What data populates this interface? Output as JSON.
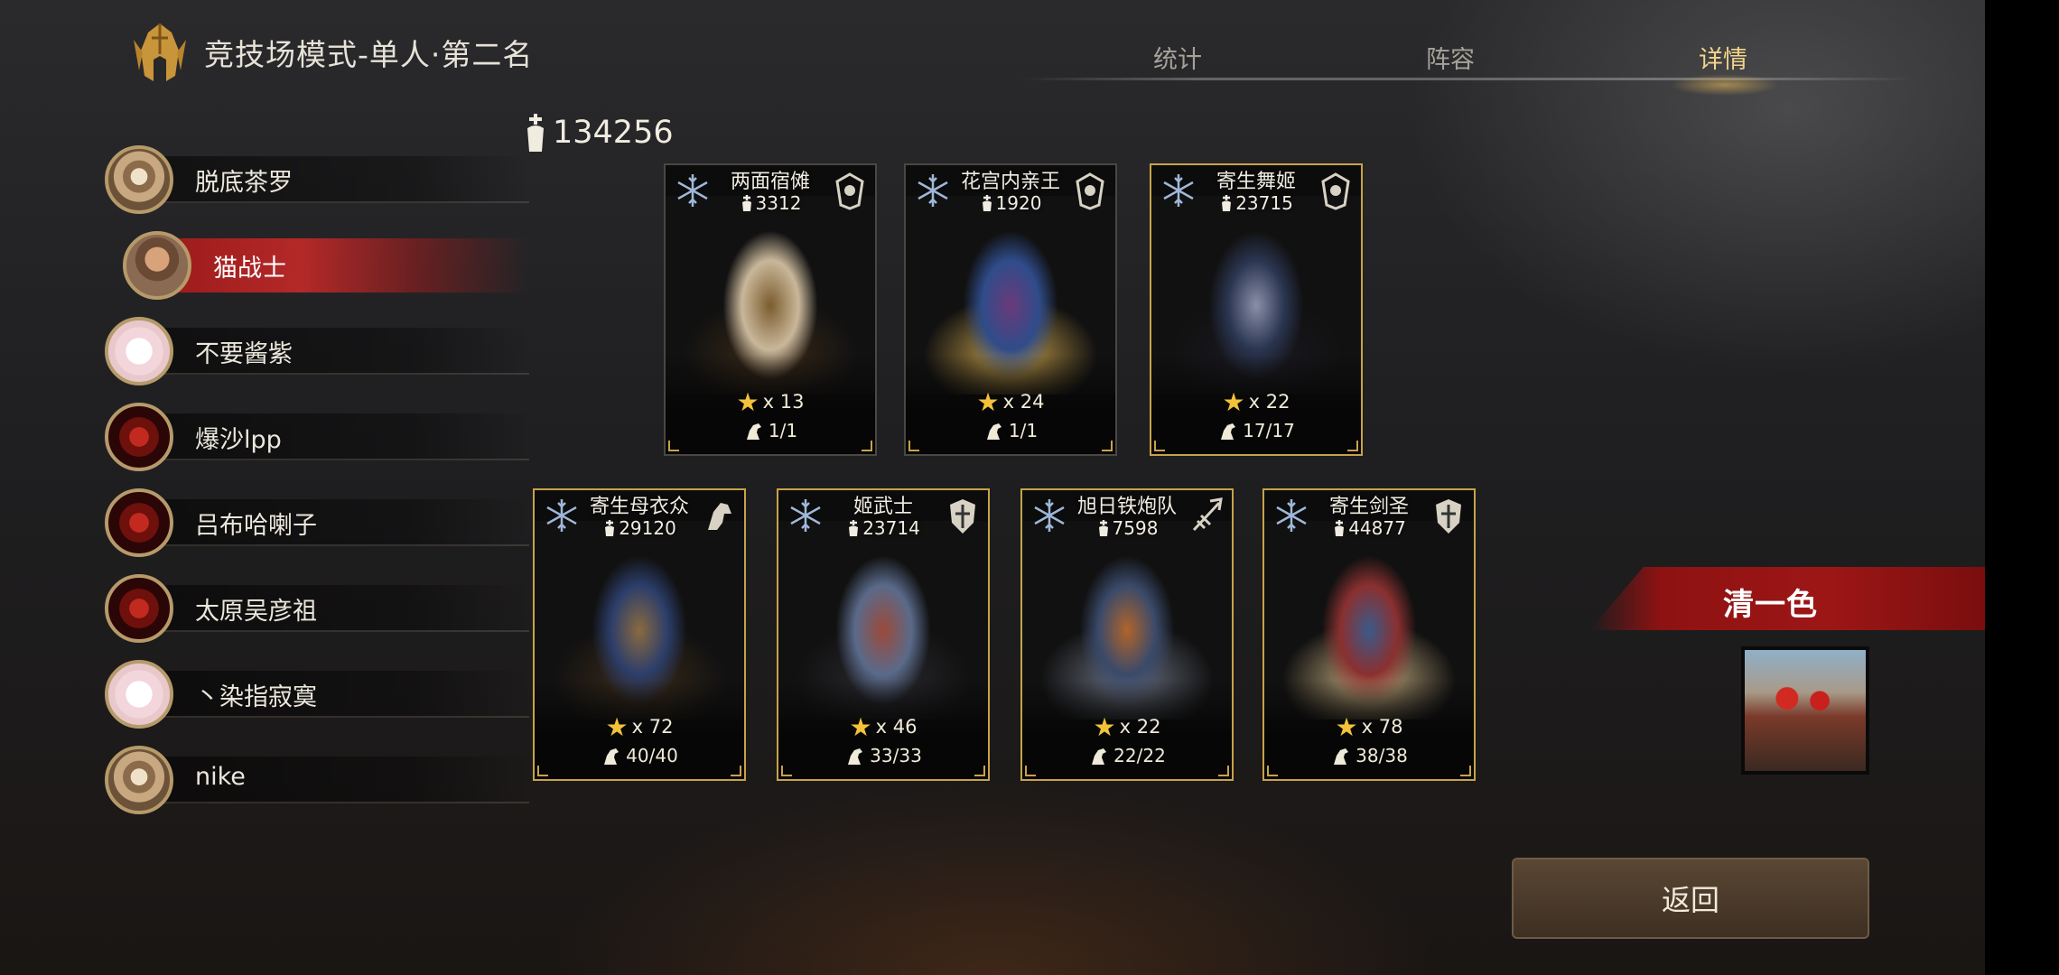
{
  "header": {
    "title": "竞技场模式-单人·第二名"
  },
  "tabs": [
    {
      "label": "统计",
      "active": false
    },
    {
      "label": "阵容",
      "active": false
    },
    {
      "label": "详情",
      "active": true
    }
  ],
  "players": [
    {
      "name": "脱底茶罗",
      "avatar": "samurai",
      "selected": false
    },
    {
      "name": "猫战士",
      "avatar": "man",
      "selected": true
    },
    {
      "name": "不要酱紫",
      "avatar": "pink",
      "selected": false
    },
    {
      "name": "爆沙lpp",
      "avatar": "oni",
      "selected": false
    },
    {
      "name": "吕布哈喇子",
      "avatar": "oni",
      "selected": false
    },
    {
      "name": "太原吴彦祖",
      "avatar": "oni",
      "selected": false
    },
    {
      "name": "丶染指寂寞",
      "avatar": "pink",
      "selected": false
    },
    {
      "name": "nike",
      "avatar": "samurai",
      "selected": false
    }
  ],
  "total_power": "134256",
  "cards": [
    {
      "name": "两面宿傩",
      "power": "3312",
      "stars": "x 13",
      "troops": "1/1",
      "class_icon": "crest-icon",
      "frame": "silver"
    },
    {
      "name": "花宫内亲王",
      "power": "1920",
      "stars": "x 24",
      "troops": "1/1",
      "class_icon": "crest-icon",
      "frame": "silver"
    },
    {
      "name": "寄生舞姬",
      "power": "23715",
      "stars": "x 22",
      "troops": "17/17",
      "class_icon": "crest-icon",
      "frame": "gold"
    },
    {
      "name": "寄生母衣众",
      "power": "29120",
      "stars": "x 72",
      "troops": "40/40",
      "class_icon": "cavalry-icon",
      "frame": "gold"
    },
    {
      "name": "姬武士",
      "power": "23714",
      "stars": "x 46",
      "troops": "33/33",
      "class_icon": "shield-icon",
      "frame": "gold"
    },
    {
      "name": "旭日铁炮队",
      "power": "7598",
      "stars": "x 22",
      "troops": "22/22",
      "class_icon": "ranged-icon",
      "frame": "gold"
    },
    {
      "name": "寄生剑圣",
      "power": "44877",
      "stars": "x 78",
      "troops": "38/38",
      "class_icon": "shield-icon",
      "frame": "gold"
    }
  ],
  "combo": {
    "label": "清一色"
  },
  "back_label": "返回",
  "colors": {
    "accent_gold": "#c8a24a",
    "selected_red": "#b42828",
    "star": "#f4c23a"
  }
}
